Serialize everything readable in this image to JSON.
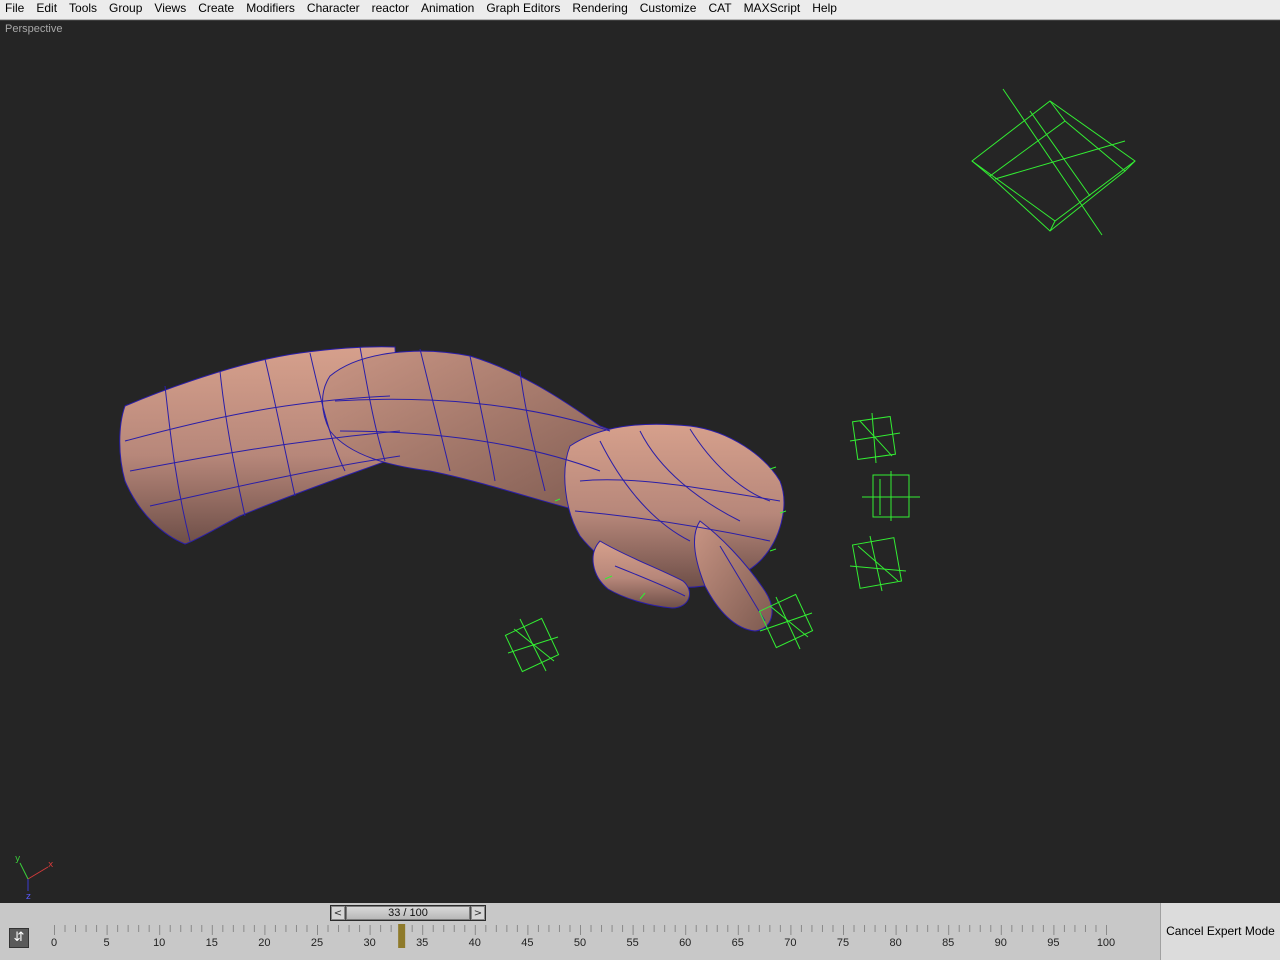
{
  "menubar": {
    "items": [
      "File",
      "Edit",
      "Tools",
      "Group",
      "Views",
      "Create",
      "Modifiers",
      "Character",
      "reactor",
      "Animation",
      "Graph Editors",
      "Rendering",
      "Customize",
      "CAT",
      "MAXScript",
      "Help"
    ]
  },
  "viewport": {
    "label": "Perspective",
    "axis": {
      "x": "x",
      "y": "y",
      "z": "z"
    },
    "colors": {
      "background": "#252525",
      "mesh_fill": "#b98877",
      "wire": "#2a1ea8",
      "helpers": "#33ee33"
    }
  },
  "timeslider": {
    "readout": "33 / 100",
    "current_frame": 33,
    "total_frames": 100,
    "prev_label": "<",
    "next_label": ">"
  },
  "trackbar": {
    "ticks": [
      "0",
      "5",
      "10",
      "15",
      "20",
      "25",
      "30",
      "35",
      "40",
      "45",
      "50",
      "55",
      "60",
      "65",
      "70",
      "75",
      "80",
      "85",
      "90",
      "95",
      "100"
    ],
    "key_frame": 33,
    "key_color": "#8e7a2a"
  },
  "status": {
    "cancel_expert": "Cancel Expert Mode"
  }
}
